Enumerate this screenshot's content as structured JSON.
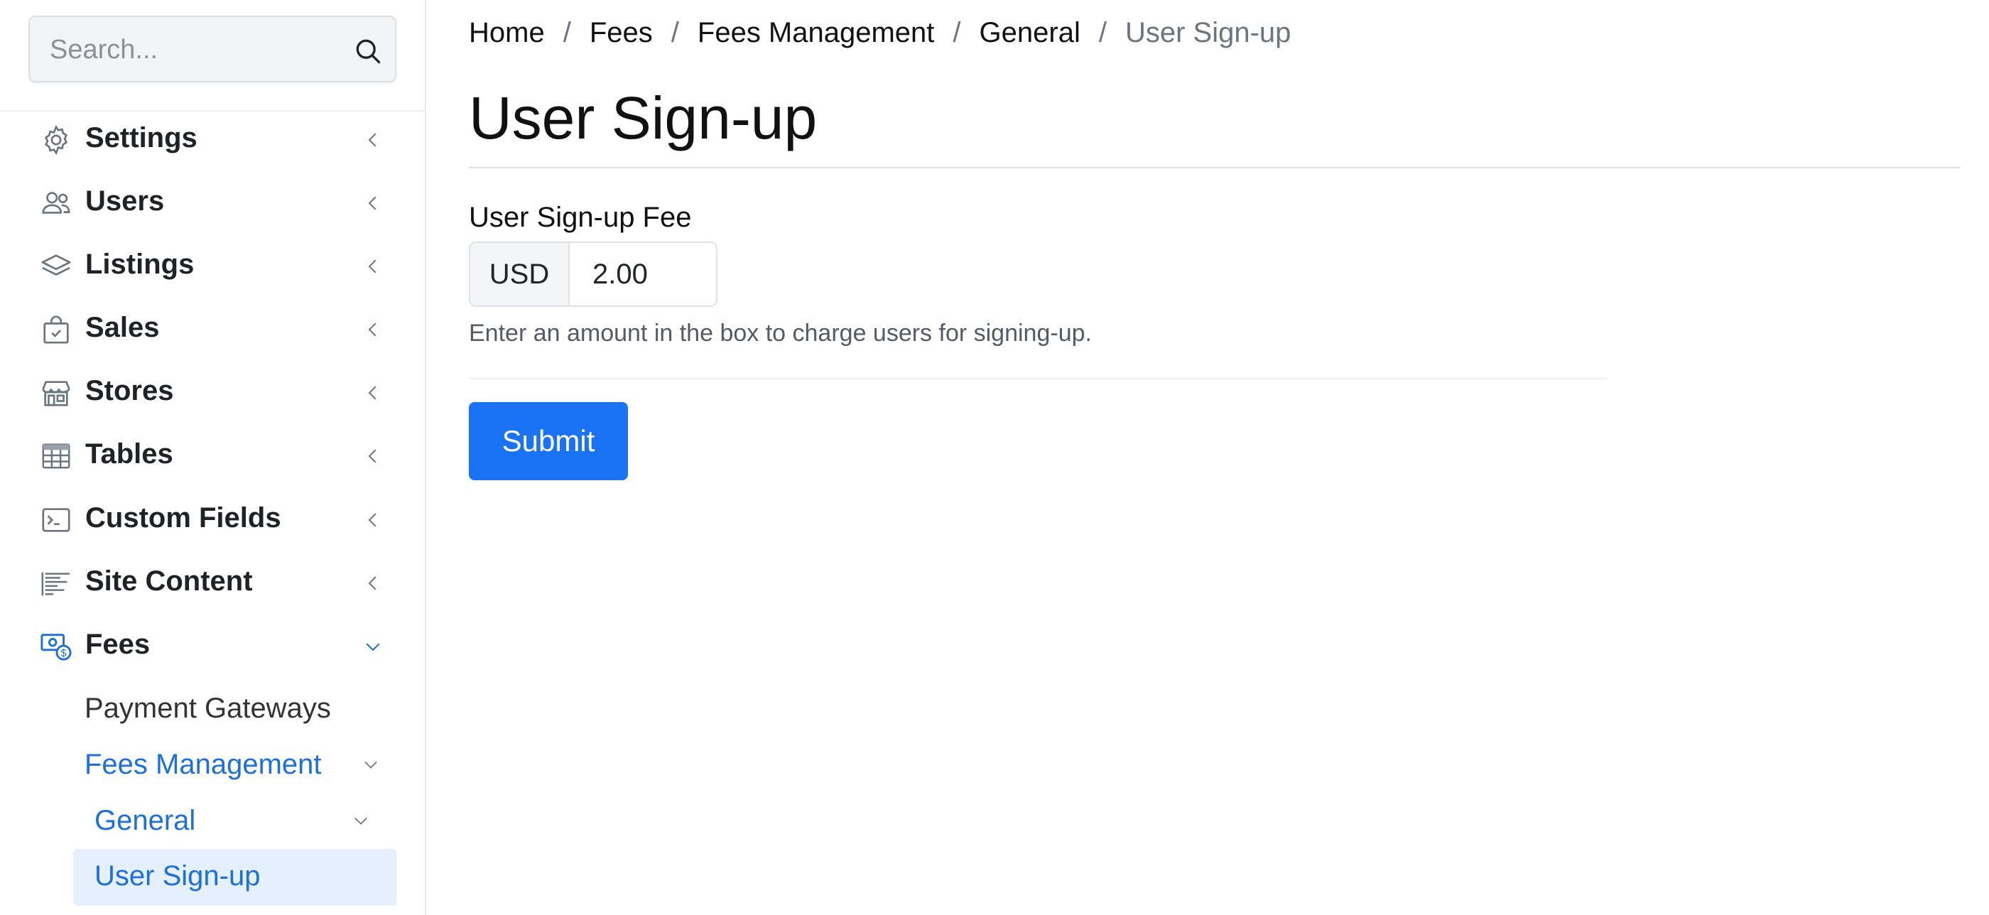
{
  "search": {
    "placeholder": "Search..."
  },
  "sidebar": {
    "items": [
      {
        "label": "Settings"
      },
      {
        "label": "Users"
      },
      {
        "label": "Listings"
      },
      {
        "label": "Sales"
      },
      {
        "label": "Stores"
      },
      {
        "label": "Tables"
      },
      {
        "label": "Custom Fields"
      },
      {
        "label": "Site Content"
      },
      {
        "label": "Fees"
      }
    ],
    "fees_children": {
      "payment_gateways": "Payment Gateways",
      "fees_management": "Fees Management",
      "general": "General",
      "user_signup": "User Sign-up"
    }
  },
  "breadcrumb": [
    "Home",
    "Fees",
    "Fees Management",
    "General",
    "User Sign-up"
  ],
  "page": {
    "title": "User Sign-up",
    "field_label": "User Sign-up Fee",
    "currency": "USD",
    "amount": "2.00",
    "help": "Enter an amount in the box to charge users for signing-up.",
    "submit_label": "Submit"
  },
  "colors": {
    "accent": "#1a72f5",
    "active_bg": "#e5f0ff",
    "link": "#1d6fe0"
  }
}
